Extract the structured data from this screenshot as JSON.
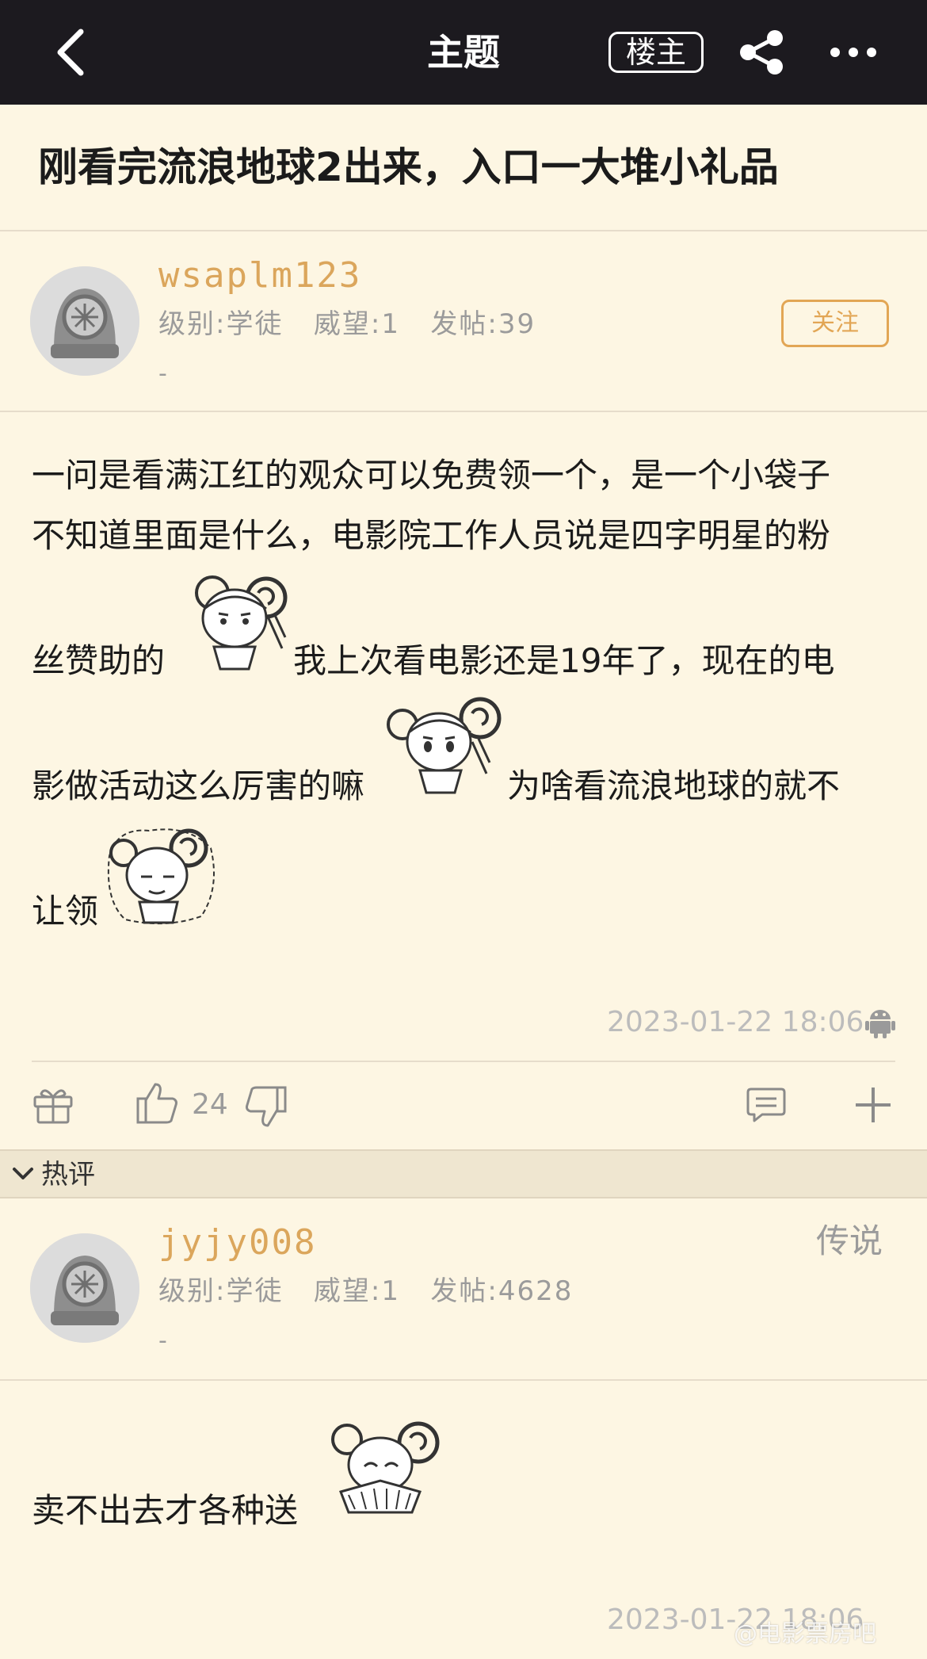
{
  "header": {
    "title": "主题",
    "op_label": "楼主"
  },
  "thread": {
    "title": "刚看完流浪地球2出来，入口一大堆小礼品"
  },
  "post": {
    "username": "wsaplm123",
    "stats": "级别:学徒   威望:1   发帖:39",
    "dash": "-",
    "follow_label": "关注",
    "lines": [
      "一问是看满江红的观众可以免费领一个，是一个小袋子",
      "不知道里面是什么，电影院工作人员说是四字明星的粉",
      "丝赞助的",
      "我上次看电影还是19年了，现在的电",
      "影做活动这么厉害的嘛",
      "为啥看流浪地球的就不",
      "让领"
    ],
    "timestamp": "2023-01-22 18:06",
    "device_icon": "android-icon",
    "like_count": "24"
  },
  "hot_comments": {
    "label": "热评"
  },
  "reply": {
    "username": "jyjy008",
    "rank": "传说",
    "stats": "级别:学徒   威望:1   发帖:4628",
    "dash": "-",
    "text": "卖不出去才各种送",
    "timestamp": "2023-01-22 18:06"
  },
  "watermark": "@电影票房吧"
}
